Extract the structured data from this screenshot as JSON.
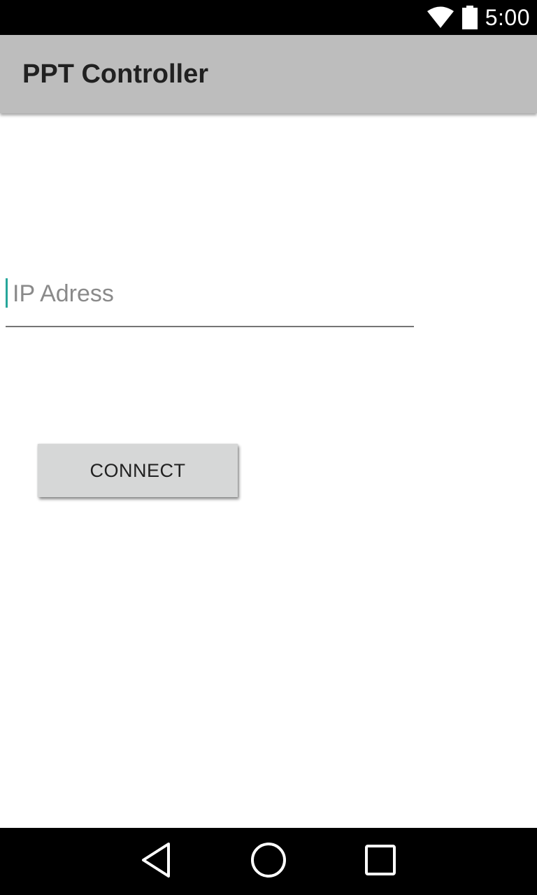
{
  "status_bar": {
    "time": "5:00",
    "icons": [
      "wifi-icon",
      "battery-icon"
    ],
    "background": "#000000"
  },
  "app_bar": {
    "title": "PPT Controller",
    "background": "#bdbdbd"
  },
  "form": {
    "ip_placeholder": "IP Adress",
    "ip_value": "",
    "connect_label": "CONNECT",
    "cursor_color": "#26a69a"
  },
  "nav_bar": {
    "icons": [
      "back-icon",
      "home-icon",
      "recents-icon"
    ]
  }
}
